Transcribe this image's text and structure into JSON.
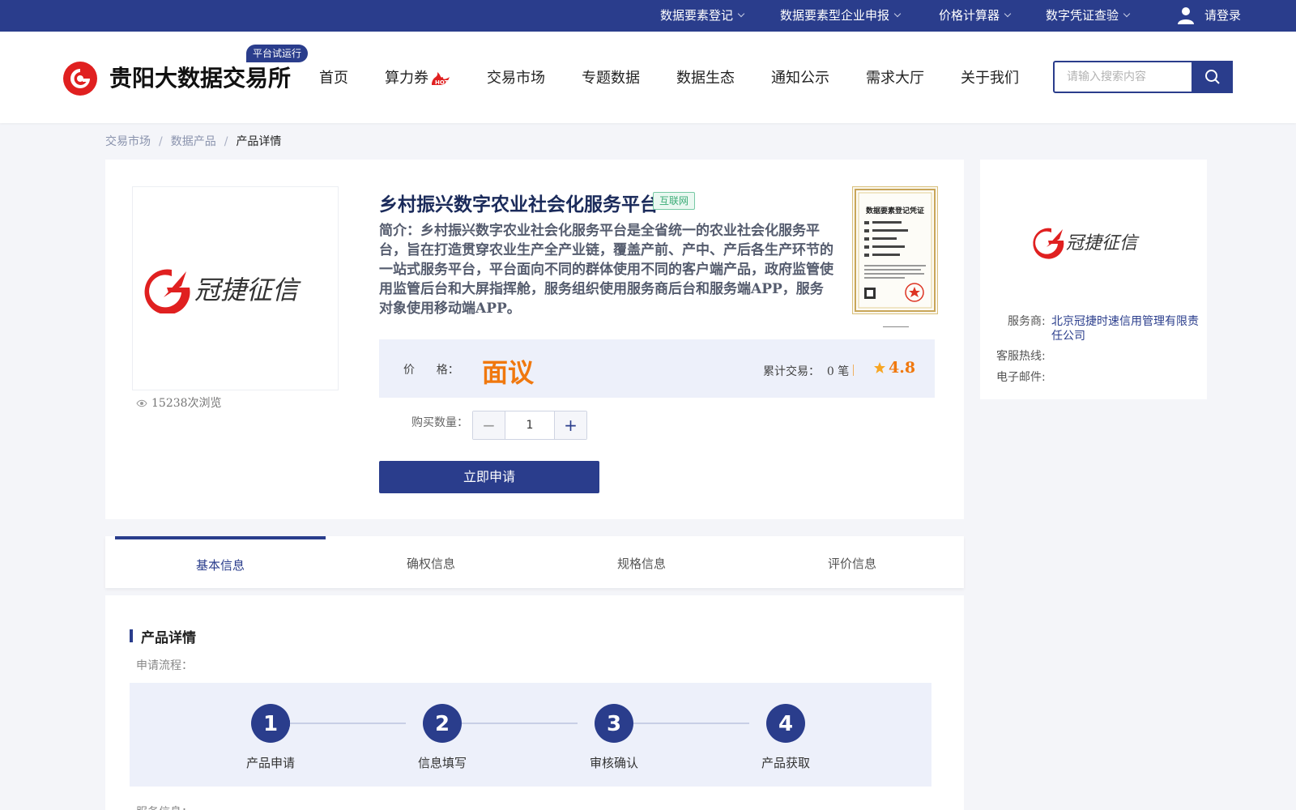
{
  "topbar": {
    "items": [
      {
        "label": "数据要素登记"
      },
      {
        "label": "数据要素型企业申报"
      },
      {
        "label": "价格计算器"
      },
      {
        "label": "数字凭证查验"
      }
    ],
    "login": "请登录"
  },
  "header": {
    "brand": "贵阳大数据交易所",
    "trial_badge": "平台试运行",
    "nav": [
      "首页",
      "算力券",
      "交易市场",
      "专题数据",
      "数据生态",
      "通知公示",
      "需求大厅",
      "关于我们"
    ],
    "hot_tag": "HOT",
    "search_placeholder": "请输入搜索内容"
  },
  "breadcrumb": [
    "交易市场",
    "数据产品",
    "产品详情"
  ],
  "breadcrumb_sep": "/",
  "product": {
    "logo_text": "冠捷征信",
    "views": "15238次浏览",
    "title": "乡村振兴数字农业社会化服务平台",
    "category": "互联网",
    "intro": "简介：乡村振兴数字农业社会化服务平台是全省统一的农业社会化服务平台，旨在打造贯穿农业生产全产业链，覆盖产前、产中、产后各生产环节的一站式服务平台，平台面向不同的群体使用不同的客户端产品，政府监管使用监管后台和大屏指挥舱，服务组织使用服务商后台和服务端APP，服务对象使用移动端APP。",
    "cert_title": "数据要素登记凭证",
    "price_label": "价      格：",
    "price_value": "面议",
    "trades": "累计交易：  0 笔",
    "rating": "4.8",
    "qty_label": "购买数量：",
    "qty_value": "1",
    "apply_label": "立即申请"
  },
  "vendor": {
    "logo_text": "冠捷征信",
    "provider_key": "服务商:",
    "provider_value": "北京冠捷时速信用管理有限责任公司",
    "hotline_key": "客服热线:",
    "email_key": "电子邮件:"
  },
  "tabs": [
    "基本信息",
    "确权信息",
    "规格信息",
    "评价信息"
  ],
  "detail": {
    "section_title": "产品详情",
    "process_label": "申请流程：",
    "steps": [
      {
        "num": "1",
        "label": "产品申请"
      },
      {
        "num": "2",
        "label": "信息填写"
      },
      {
        "num": "3",
        "label": "审核确认"
      },
      {
        "num": "4",
        "label": "产品获取"
      }
    ],
    "service_label": "服务信息："
  },
  "colors": {
    "primary": "#2a3d8c",
    "price": "#f0780e",
    "brand_red": "#e02020"
  }
}
